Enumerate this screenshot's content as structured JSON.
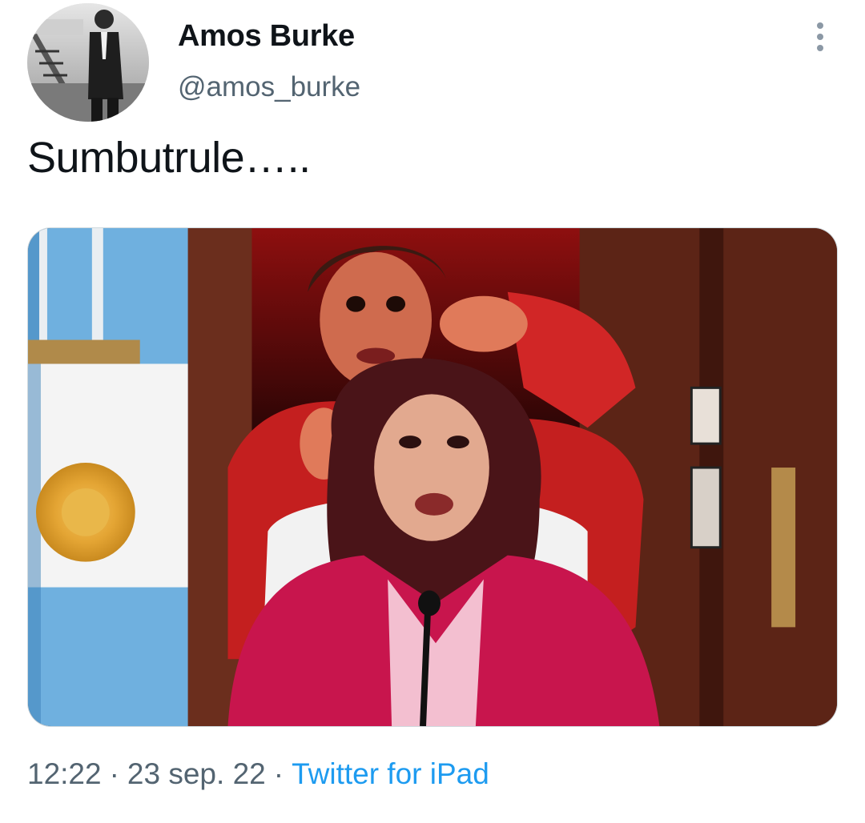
{
  "author": {
    "display_name": "Amos Burke",
    "handle": "@amos_burke"
  },
  "tweet": {
    "text": "Sumbutrule…..",
    "media_description_icon": "photo"
  },
  "meta": {
    "time": "12:22",
    "separator": "·",
    "date": "23 sep. 22",
    "source": "Twitter for iPad"
  },
  "colors": {
    "text_primary": "#0f1419",
    "text_secondary": "#536471",
    "link": "#1d9bf0"
  },
  "icons": {
    "more": "more-vertical-icon"
  }
}
